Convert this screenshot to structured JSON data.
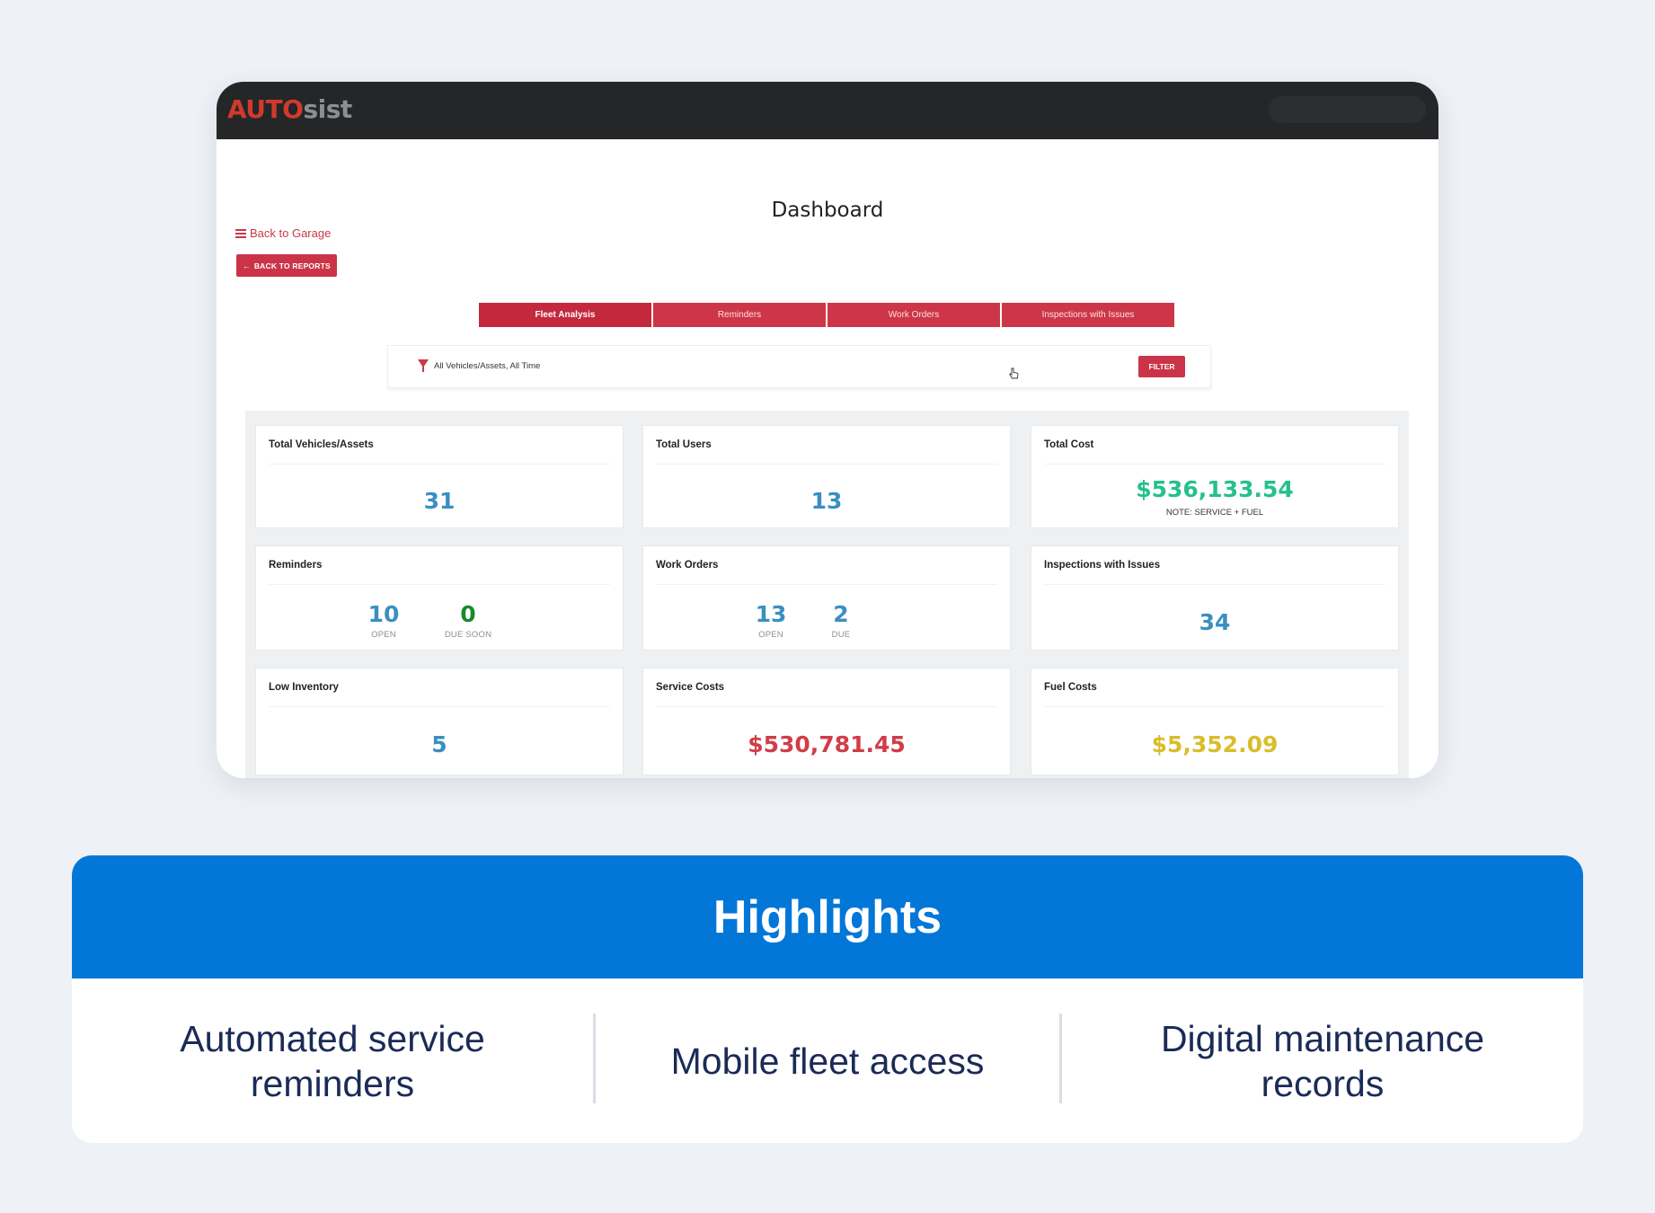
{
  "app": {
    "logo_primary": "AUTO",
    "logo_secondary": "sist",
    "page_title": "Dashboard",
    "back_to_garage": "Back to Garage",
    "back_to_reports": "BACK TO REPORTS",
    "tabs": [
      {
        "label": "Fleet Analysis",
        "active": true
      },
      {
        "label": "Reminders",
        "active": false
      },
      {
        "label": "Work Orders",
        "active": false
      },
      {
        "label": "Inspections with Issues",
        "active": false
      }
    ],
    "filter": {
      "text": "All Vehicles/Assets, All Time",
      "button": "FILTER"
    },
    "cards": {
      "total_vehicles": {
        "title": "Total Vehicles/Assets",
        "value": "31"
      },
      "total_users": {
        "title": "Total Users",
        "value": "13"
      },
      "total_cost": {
        "title": "Total Cost",
        "value": "$536,133.54",
        "note": "NOTE: SERVICE + FUEL"
      },
      "reminders": {
        "title": "Reminders",
        "open": "10",
        "open_label": "OPEN",
        "due_soon": "0",
        "due_soon_label": "DUE SOON"
      },
      "work_orders": {
        "title": "Work Orders",
        "open": "13",
        "open_label": "OPEN",
        "due": "2",
        "due_label": "DUE"
      },
      "inspections": {
        "title": "Inspections with Issues",
        "value": "34"
      },
      "low_inventory": {
        "title": "Low Inventory",
        "value": "5"
      },
      "service_costs": {
        "title": "Service Costs",
        "value": "$530,781.45"
      },
      "fuel_costs": {
        "title": "Fuel Costs",
        "value": "$5,352.09"
      }
    },
    "colors": {
      "brand_red": "#cb3448",
      "value_blue": "#3a8fc0",
      "value_green": "#188a2c",
      "value_teal": "#26c08d",
      "value_red": "#d03d48",
      "value_gold": "#d9bd2b"
    }
  },
  "highlights": {
    "title": "Highlights",
    "items": [
      {
        "line1": "Automated service",
        "line2": "reminders"
      },
      {
        "line1": "Mobile fleet access",
        "line2": ""
      },
      {
        "line1": "Digital maintenance",
        "line2": "records"
      }
    ],
    "header_color": "#0277d8"
  }
}
